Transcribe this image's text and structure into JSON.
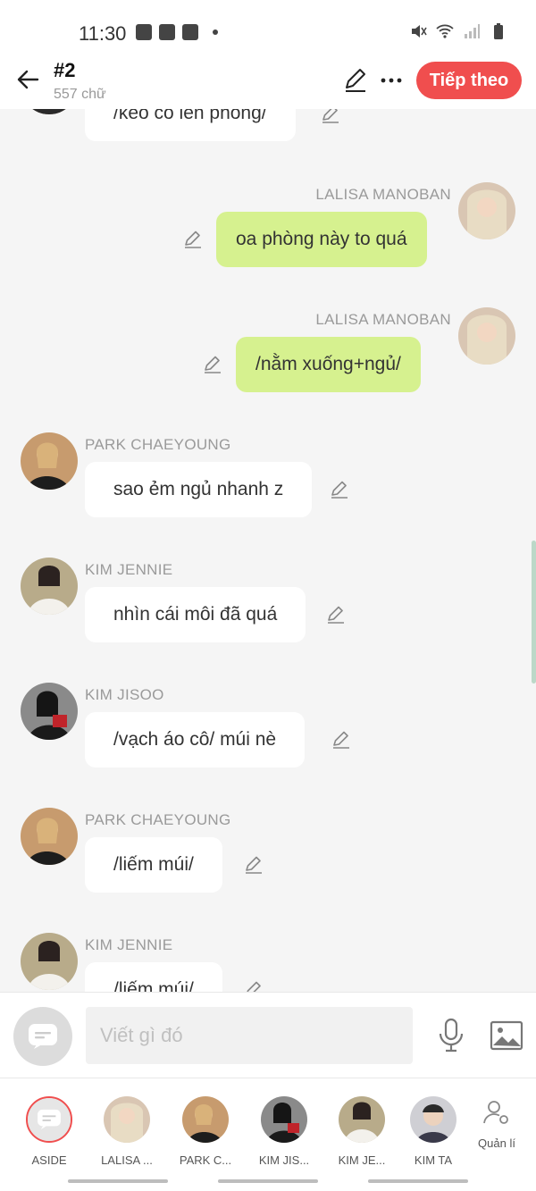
{
  "status_bar": {
    "time": "11:30"
  },
  "header": {
    "title": "#2",
    "subtitle": "557 chữ",
    "next_label": "Tiếp theo"
  },
  "messages": [
    {
      "name": "",
      "text": "/kéo cô lên phòng/",
      "side": "left"
    },
    {
      "name": "LALISA MANOBAN",
      "text": "oa phòng này to quá",
      "side": "right"
    },
    {
      "name": "LALISA MANOBAN",
      "text": "/nằm xuống+ngủ/",
      "side": "right"
    },
    {
      "name": "PARK CHAEYOUNG",
      "text": "sao ẻm ngủ nhanh z",
      "side": "left"
    },
    {
      "name": "KIM JENNIE",
      "text": "nhìn cái môi đã quá",
      "side": "left"
    },
    {
      "name": "KIM JISOO",
      "text": "/vạch áo cô/ múi nè",
      "side": "left"
    },
    {
      "name": "PARK CHAEYOUNG",
      "text": "/liếm múi/",
      "side": "left"
    },
    {
      "name": "KIM JENNIE",
      "text": "/liếm múi/",
      "side": "left"
    }
  ],
  "input": {
    "placeholder": "Viết gì đó"
  },
  "characters": [
    {
      "label": "ASIDE"
    },
    {
      "label": "LALISA ..."
    },
    {
      "label": "PARK C..."
    },
    {
      "label": "KIM JIS..."
    },
    {
      "label": "KIM JE..."
    },
    {
      "label": "KIM TA"
    }
  ],
  "manage_label": "Quản lí",
  "colors": {
    "accent": "#f04e4e",
    "right_bubble": "#d6f18f",
    "left_bubble": "#ffffff",
    "background": "#f5f5f5"
  },
  "icons": [
    "back-arrow-icon",
    "pencil-icon",
    "more-icon",
    "mic-icon",
    "image-icon",
    "chat-bubble-icon",
    "user-settings-icon"
  ]
}
